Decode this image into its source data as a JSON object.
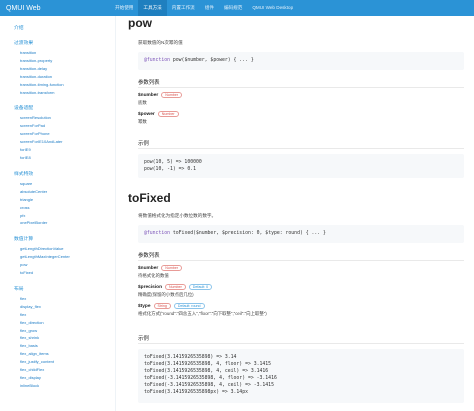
{
  "topbar": {
    "brand": "QMUI Web",
    "nav": [
      "开始使用",
      "工具方法",
      "内置工作流",
      "组件",
      "编码规范",
      "QMUI Web Desktop"
    ],
    "active_index": 1
  },
  "sidebar": {
    "groups": [
      {
        "title": "介绍",
        "items": []
      },
      {
        "title": "过渡效果",
        "items": [
          "transition",
          "transition-property",
          "transition-delay",
          "transition-duration",
          "transition-timing-function",
          "transition-transform"
        ]
      },
      {
        "title": "设备适配",
        "items": [
          "screenResolution",
          "screenForPad",
          "screenForPhone",
          "screenForIE10AndLater",
          "forIE9",
          "forIE8"
        ]
      },
      {
        "title": "样式特效",
        "items": [
          "square",
          "absoluteCenter",
          "triangle",
          "cross",
          "pfx",
          "onePixelBorder"
        ]
      },
      {
        "title": "数值计算",
        "items": [
          "getLengthDirectionValue",
          "getLengthMaxIntegerCenter",
          "pow",
          "toFixed"
        ]
      },
      {
        "title": "布局",
        "items": [
          "flex",
          "display_flex",
          "flex",
          "flex_direction",
          "flex_grow",
          "flex_shrink",
          "flex_basis",
          "flex_align_items",
          "flex_justify_content",
          "flex_childFlex",
          "flex_display",
          "inlineBlock"
        ]
      }
    ]
  },
  "pow": {
    "title": "pow",
    "desc": "获取数值的N次幂的值",
    "signature": {
      "kw": "@function",
      "rest": " pow($number, $power) { ... }"
    },
    "params_heading": "参数列表",
    "params": [
      {
        "name": "$number",
        "type": "Number",
        "desc": "底数"
      },
      {
        "name": "$power",
        "type": "Number",
        "desc": "幂数"
      }
    ],
    "example_heading": "示例",
    "example_lines": [
      "pow(10, 5) => 100000",
      "pow(10, -1) => 0.1"
    ]
  },
  "tofixed": {
    "title": "toFixed",
    "desc": "将数值格式化为指定小数位数的数字。",
    "signature": {
      "kw": "@function",
      "rest": " toFixed($number, $precision: 0, $type: round) { ... }"
    },
    "params_heading": "参数列表",
    "params": [
      {
        "name": "$number",
        "type": "Number",
        "default": "",
        "desc": "待格式化的数值"
      },
      {
        "name": "$precision",
        "type": "Number",
        "default": "Default: 0",
        "desc": "精确度(保留的小数点后几位)"
      },
      {
        "name": "$type",
        "type": "String",
        "default": "Default: round",
        "desc": "格式化方式(\"round\":\"四舍五入\",\"floor\":\"向下取整\",\"ceil\":\"向上取整\")"
      }
    ],
    "example_heading": "示例",
    "example_lines": [
      "toFixed(3.1415926535898) => 3.14",
      "toFixed(3.1415926535898, 4, floor) => 3.1415",
      "toFixed(3.1415926535898, 4, ceil) => 3.1416",
      "toFixed(-3.1415926535898, 4, floor) => -3.1416",
      "toFixed(-3.1415926535898, 4, ceil) => -3.1415",
      "toFixed(3.1415926535898px) => 3.14px"
    ]
  }
}
